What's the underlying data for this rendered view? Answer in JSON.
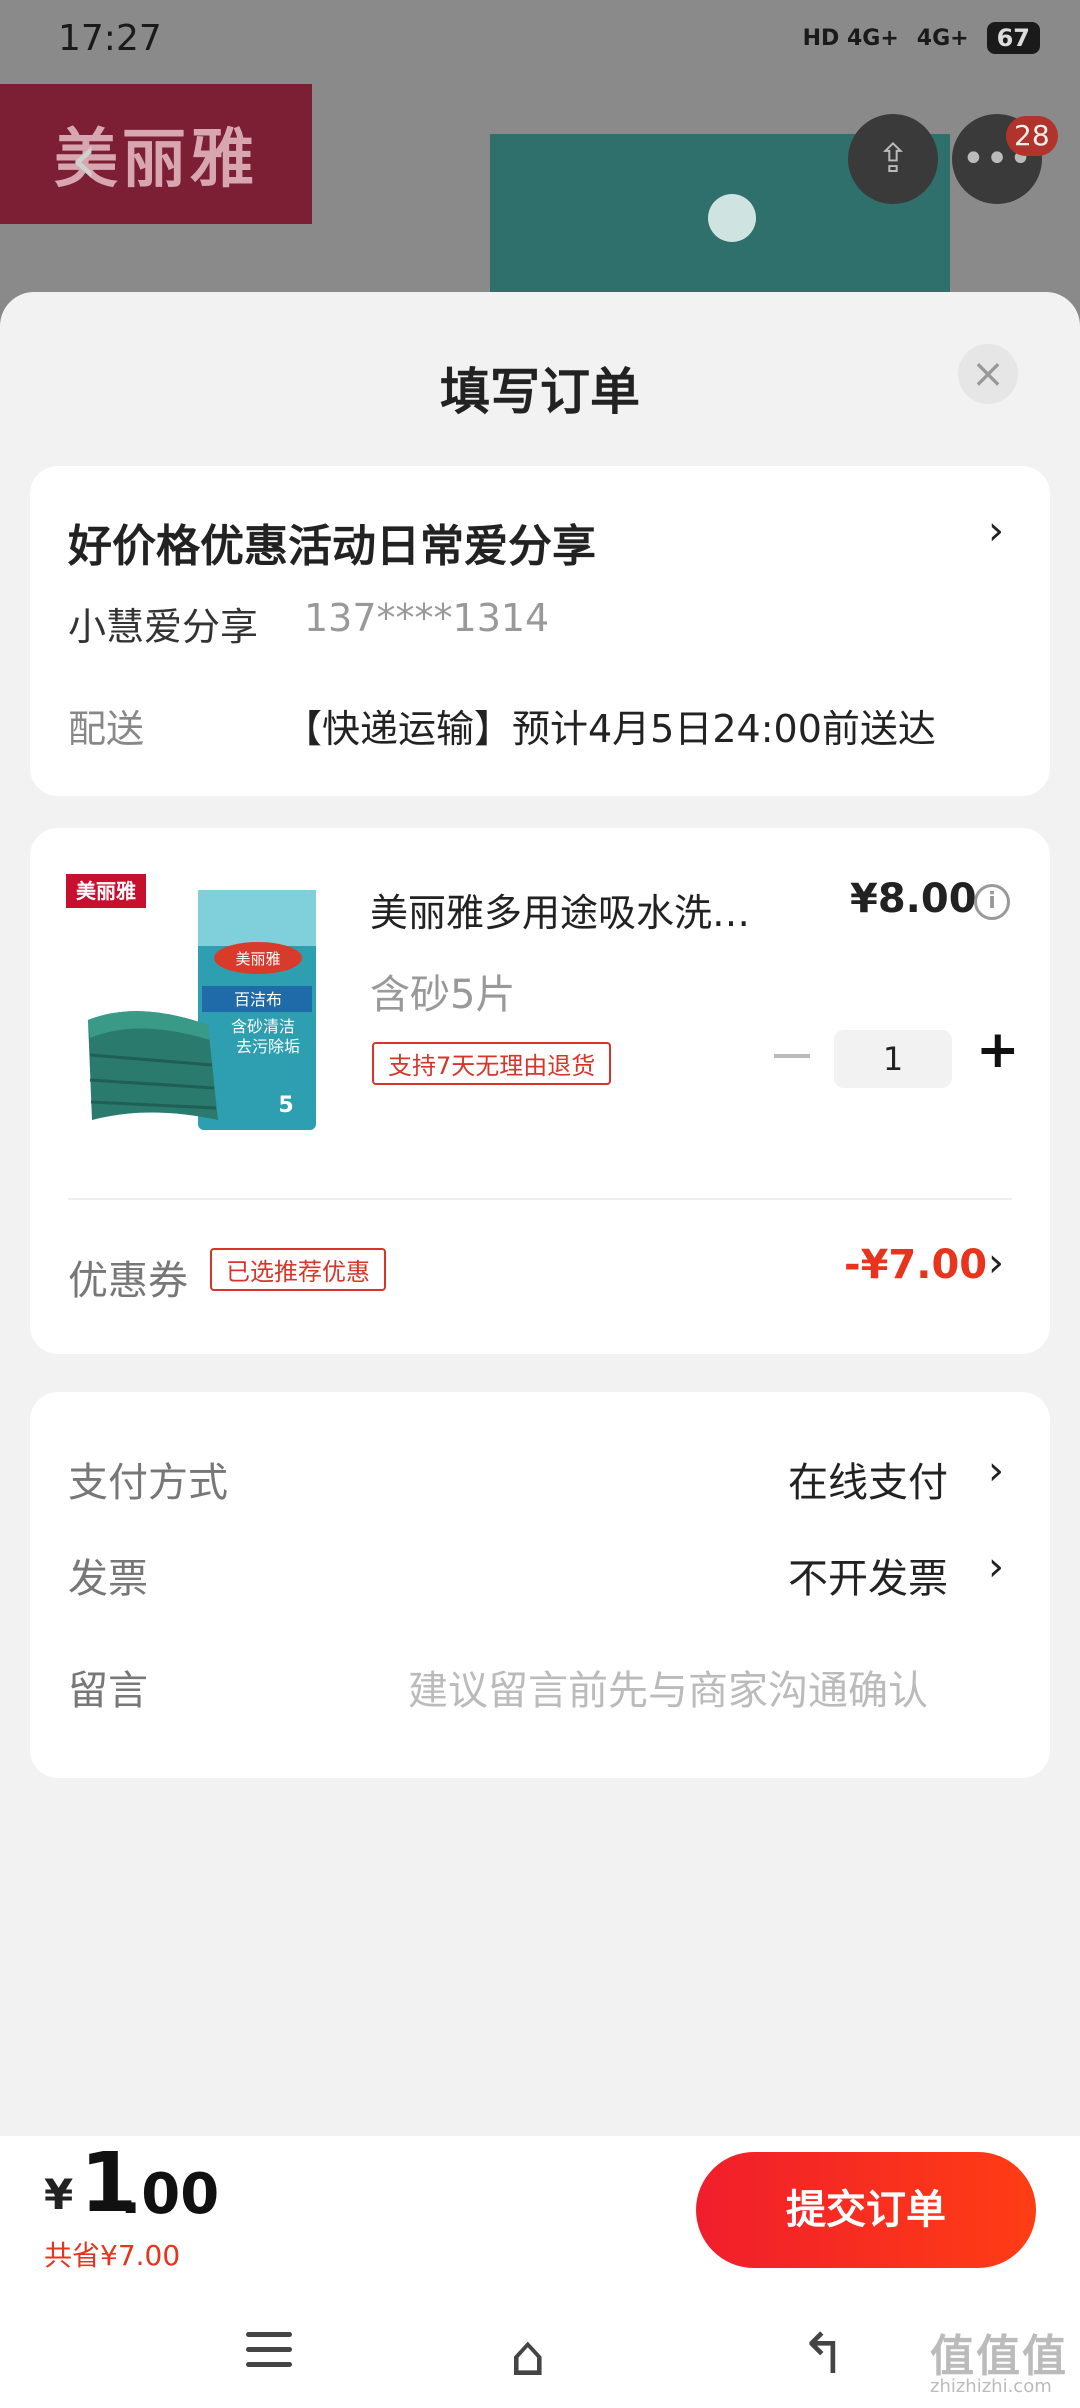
{
  "status_bar": {
    "time": "17:27",
    "signal1": "HD 4G+",
    "signal2": "4G+",
    "battery": "67"
  },
  "background": {
    "shop_logo_text": "美丽雅",
    "badge_count": "28",
    "colors": {
      "dim_overlay": "#888888",
      "accent": "#e8341c"
    }
  },
  "sheet": {
    "title": "填写订单",
    "close_icon": "close-icon",
    "address": {
      "title": "好价格优惠活动日常爱分享",
      "name": "小慧爱分享",
      "phone": "137****1314",
      "shipping_label": "配送",
      "shipping_value": "【快递运输】预计4月5日24:00前送达"
    },
    "goods": {
      "shop_badge": "美丽雅",
      "name": "美丽雅多用途吸水洗…",
      "price": "¥8.00",
      "spec": "含砂5片",
      "return_tag": "支持7天无理由退货",
      "quantity": "1",
      "package_text_1": "美丽雅",
      "package_text_2": "百洁布",
      "package_text_3": "含砂清洁",
      "package_text_4": "去污除垢",
      "package_count": "5",
      "coupon_label": "优惠券",
      "coupon_tag": "已选推荐优惠",
      "coupon_value": "-¥7.00"
    },
    "payment": {
      "method_label": "支付方式",
      "method_value": "在线支付",
      "invoice_label": "发票",
      "invoice_value": "不开发票",
      "note_label": "留言",
      "note_placeholder": "建议留言前先与商家沟通确认"
    }
  },
  "bottom_bar": {
    "currency": "¥",
    "price_int": "1",
    "price_dec": ".00",
    "saved": "共省¥7.00",
    "submit_label": "提交订单"
  },
  "watermark": {
    "text": "值值值",
    "url": "zhizhizhi.com"
  }
}
